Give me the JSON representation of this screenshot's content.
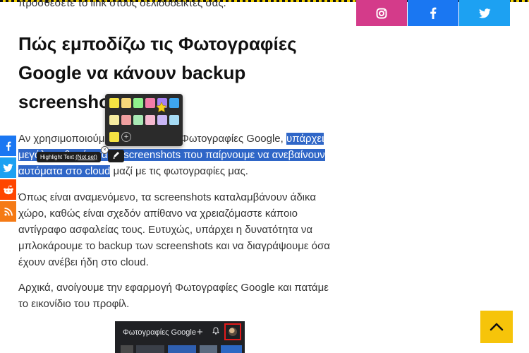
{
  "article": {
    "partial_top_line": "προσθέσετε το link στους σελιδοδείκτες σας.",
    "heading": "Πώς εμποδίζω τις Φωτογραφίες Google να κάνουν backup screenshots",
    "para1_plain": "Αν χρησιμοποιούμε την εφαρμογή Φωτογραφίες Google, ",
    "para1_highlight": "υπάρχει μεγάλη πιθανότητα τα screenshots που παίρνουμε να ανεβαίνουν αυτόματα στο cloud",
    "para1_rest": " μαζί με τις φωτογραφίες μας.",
    "para2": "Όπως είναι αναμενόμενο, τα screenshots καταλαμβάνουν άδικα χώρο, καθώς είναι σχεδόν απίθανο να χρειαζόμαστε κάποιο αντίγραφο ασφαλείας τους. Ευτυχώς, υπάρχει η δυνατότητα να μπλοκάρουμε το backup των screenshots και να διαγράψουμε όσα έχουν ανέβει ήδη στο cloud.",
    "para3": "Αρχικά, ανοίγουμε την εφαρμογή Φωτογραφίες Google και πατάμε το εικονίδιο του προφίλ."
  },
  "share_top": {
    "instagram_icon": "instagram-icon",
    "facebook_icon": "facebook-icon",
    "twitter_icon": "twitter-icon",
    "colors": {
      "instagram": "#d43b8a",
      "facebook": "#1a77f2",
      "twitter": "#1da1f2"
    }
  },
  "share_side": {
    "icons": [
      "facebook-icon",
      "twitter-icon",
      "reddit-icon",
      "rss-icon"
    ]
  },
  "highlighter": {
    "tooltip_label": "Highlight Text",
    "tooltip_status": "(Not set)",
    "plus_label": "+",
    "pen_icon": "pen-icon",
    "swatch_colors_row1": [
      "#f5e342",
      "#f7d87a",
      "#8ff08c",
      "#f27ca8",
      "#a680f2",
      "#3ea6f0"
    ],
    "swatch_colors_row2": [
      "#f6eba0",
      "#f0a0a0",
      "#a8e8b4",
      "#f5b8cf",
      "#c9b6f5",
      "#a6dbf5"
    ],
    "swatch_colors_row3": [
      "#f5e342"
    ]
  },
  "embed_screenshot": {
    "title": "Φωτογραφίες Google",
    "plus_label": "+",
    "bell_icon": "notification-icon",
    "avatar_icon": "profile-avatar"
  },
  "scroll_top": {
    "icon": "chevron-up-icon",
    "color": "#f6c40a"
  }
}
